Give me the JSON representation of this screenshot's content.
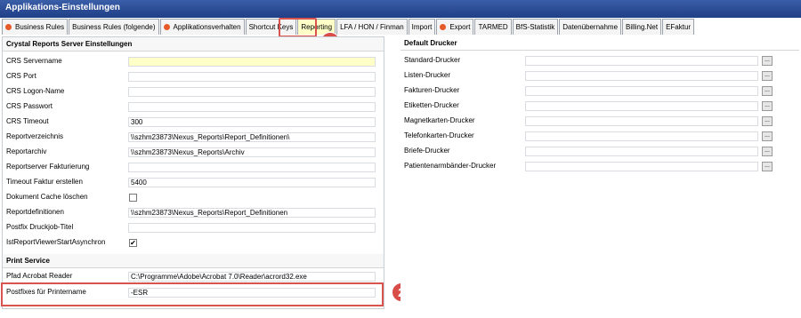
{
  "window": {
    "title": "Applikations-Einstellungen"
  },
  "tabs": [
    {
      "label": "Business Rules",
      "dot": true
    },
    {
      "label": "Business Rules (folgende)",
      "dot": false
    },
    {
      "label": "Applikationsverhalten",
      "dot": true
    },
    {
      "label": "Shortcut Keys",
      "dot": false
    },
    {
      "label": "Reporting",
      "dot": false,
      "active": true
    },
    {
      "label": "LFA / HON / Finman",
      "dot": false
    },
    {
      "label": "Import",
      "dot": false
    },
    {
      "label": "Export",
      "dot": true
    },
    {
      "label": "TARMED",
      "dot": false
    },
    {
      "label": "BfS-Statistik",
      "dot": false
    },
    {
      "label": "Datenübernahme",
      "dot": false
    },
    {
      "label": "Billing.Net",
      "dot": false
    },
    {
      "label": "EFaktur",
      "dot": false
    }
  ],
  "annotations": {
    "badge1": "1",
    "badge2": "2",
    "accent": "#d9534f"
  },
  "left": {
    "section1": "Crystal Reports Server Einstellungen",
    "rows": [
      {
        "label": "CRS Servername",
        "value": "",
        "yellow": true
      },
      {
        "label": "CRS Port",
        "value": ""
      },
      {
        "label": "CRS Logon-Name",
        "value": ""
      },
      {
        "label": "CRS Passwort",
        "value": ""
      },
      {
        "label": "CRS Timeout",
        "value": "300"
      },
      {
        "label": "Reportverzeichnis",
        "value": "\\\\szhm23873\\Nexus_Reports\\Report_Definitionen\\"
      },
      {
        "label": "Reportarchiv",
        "value": "\\\\szhm23873\\Nexus_Reports\\Archiv"
      },
      {
        "label": "Reportserver Fakturierung",
        "value": ""
      },
      {
        "label": "Timeout Faktur erstellen",
        "value": "5400"
      },
      {
        "label": "Dokument Cache löschen",
        "checkbox": true,
        "checked": false
      },
      {
        "label": "Reportdefinitionen",
        "value": "\\\\szhm23873\\Nexus_Reports\\Report_Definitionen"
      },
      {
        "label": "Postfix Druckjob-Titel",
        "value": ""
      },
      {
        "label": "IstReportViewerStartAsynchron",
        "checkbox": true,
        "checked": true
      }
    ],
    "section2": "Print Service",
    "print_rows": [
      {
        "label": "Pfad Acrobat Reader",
        "value": "C:\\Programme\\Adobe\\Acrobat 7.0\\Reader\\acrord32.exe"
      },
      {
        "label": "Postfixes für Printername",
        "value": "-ESR"
      }
    ]
  },
  "right": {
    "section": "Default Drucker",
    "rows": [
      {
        "label": "Standard-Drucker",
        "button": "..."
      },
      {
        "label": "Listen-Drucker",
        "button": "..."
      },
      {
        "label": "Fakturen-Drucker",
        "button": "..."
      },
      {
        "label": "Etiketten-Drucker",
        "button": "..."
      },
      {
        "label": "Magnetkarten-Drucker",
        "button": "..."
      },
      {
        "label": "Telefonkarten-Drucker",
        "button": "..."
      },
      {
        "label": "Briefe-Drucker",
        "button": "..."
      },
      {
        "label": "Patientenarmbänder-Drucker",
        "button": "..."
      }
    ]
  }
}
